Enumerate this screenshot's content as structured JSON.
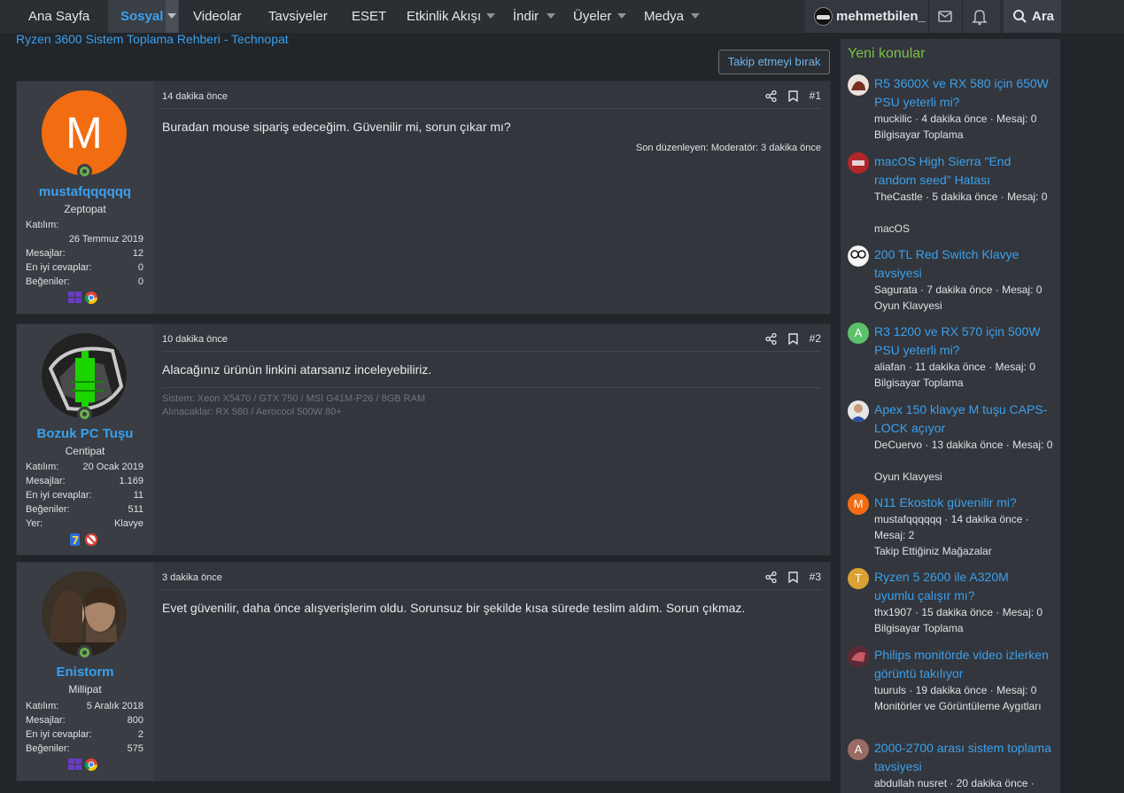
{
  "nav": {
    "items": [
      {
        "label": "Ana Sayfa"
      },
      {
        "label": "Sosyal"
      },
      {
        "label": "Videolar"
      },
      {
        "label": "Tavsiyeler"
      },
      {
        "label": "ESET"
      },
      {
        "label": "Etkinlik Akışı"
      },
      {
        "label": "İndir"
      },
      {
        "label": "Üyeler"
      },
      {
        "label": "Medya"
      }
    ],
    "username": "mehmetbilen_",
    "search_label": "Ara",
    "accent_color": "#3aa0ee"
  },
  "breadcrumb": "Ryzen 3600 Sistem Toplama Rehberi - Technopat",
  "follow_button": "Takip etmeyi bırak",
  "posts": [
    {
      "username": "mustafqqqqqq",
      "user_title": "Zeptopat",
      "avatar_letter": "M",
      "stats": [
        {
          "label": "Katılım:",
          "value": "26 Temmuz 2019"
        },
        {
          "label": "Mesajlar:",
          "value": "12"
        },
        {
          "label": "En iyi cevaplar:",
          "value": "0"
        },
        {
          "label": "Beğeniler:",
          "value": "0"
        }
      ],
      "time": "14 dakika önce",
      "number": "#1",
      "text": "Buradan mouse sipariş edeceğim. Güvenilir mi, sorun çıkar mı?",
      "edit_note": "Son düzenleyen: Moderatör: 3 dakika önce"
    },
    {
      "username": "Bozuk PC Tuşu",
      "user_title": "Centipat",
      "stats": [
        {
          "label": "Katılım:",
          "value": "20 Ocak 2019"
        },
        {
          "label": "Mesajlar:",
          "value": "1.169"
        },
        {
          "label": "En iyi cevaplar:",
          "value": "11"
        },
        {
          "label": "Beğeniler:",
          "value": "511"
        },
        {
          "label": "Yer:",
          "value": "Klavye"
        }
      ],
      "time": "10 dakika önce",
      "number": "#2",
      "text": "Alacağınız ürünün linkini atarsanız inceleyebiliriz.",
      "signature": [
        "Sistem: Xeon X5470 / GTX 750 / MSI G41M-P26 / 8GB RAM",
        "Alınacaklar: RX 580 / Aerocool 500W 80+"
      ]
    },
    {
      "username": "Enistorm",
      "user_title": "Millipat",
      "stats": [
        {
          "label": "Katılım:",
          "value": "5 Aralık 2018"
        },
        {
          "label": "Mesajlar:",
          "value": "800"
        },
        {
          "label": "En iyi cevaplar:",
          "value": "2"
        },
        {
          "label": "Beğeniler:",
          "value": "575"
        }
      ],
      "time": "3 dakika önce",
      "number": "#3",
      "text": "Evet güvenilir, daha önce alışverişlerim oldu. Sorunsuz bir şekilde kısa sürede teslim aldım. Sorun çıkmaz."
    }
  ],
  "sidebar": {
    "title": "Yeni konular",
    "threads": [
      {
        "title": "R5 3600X ve RX 580 için 650W PSU yeterli mi?",
        "meta": "muckilic · 4 dakika önce · Mesaj: 0",
        "forum": "Bilgisayar Toplama",
        "avatar_letter": "",
        "avatar_color": "#8a4b3b"
      },
      {
        "title": "macOS High Sierra \"End random seed\" Hatası",
        "meta": "TheCastle · 5 dakika önce · Mesaj: 0",
        "forum": "macOS",
        "avatar_letter": "",
        "avatar_color": "#b0262b"
      },
      {
        "title": "200 TL Red Switch Klavye tavsiyesi",
        "meta": "Sagurata · 7 dakika önce · Mesaj: 0",
        "forum": "Oyun Klavyesi",
        "avatar_letter": "",
        "avatar_color": "#1a1a1a"
      },
      {
        "title": "R3 1200 ve RX 570 için 500W PSU yeterli mi?",
        "meta": "aliafan · 11 dakika önce · Mesaj: 0",
        "forum": "Bilgisayar Toplama",
        "avatar_letter": "A",
        "avatar_color": "#5cc16a"
      },
      {
        "title": "Apex 150 klavye M tuşu CAPS-LOCK açıyor",
        "meta": "DeCuervo · 13 dakika önce · Mesaj: 0",
        "forum": "Oyun Klavyesi",
        "avatar_letter": "",
        "avatar_color": "#d9d9d9"
      },
      {
        "title": "N11 Ekostok güvenilir mi?",
        "meta": "mustafqqqqqq · 14 dakika önce · Mesaj: 2",
        "forum": "Takip Ettiğiniz Mağazalar",
        "avatar_letter": "M",
        "avatar_color": "#f26c11"
      },
      {
        "title": "Ryzen 5 2600 ile A320M uyumlu çalışır mı?",
        "meta": "thx1907 · 15 dakika önce · Mesaj: 0",
        "forum": "Bilgisayar Toplama",
        "avatar_letter": "T",
        "avatar_color": "#d9a233"
      },
      {
        "title": "Philips monitörde video izlerken görüntü takılıyor",
        "meta": "tuuruls · 19 dakika önce · Mesaj: 0",
        "forum": "Monitörler ve Görüntüleme Aygıtları",
        "avatar_letter": "",
        "avatar_color": "#7a3b44"
      },
      {
        "title": "2000-2700 arası sistem toplama tavsiyesi",
        "meta": "abdullah nusret · 20 dakika önce ·",
        "forum": "",
        "avatar_letter": "A",
        "avatar_color": "#9a6b63"
      }
    ]
  }
}
